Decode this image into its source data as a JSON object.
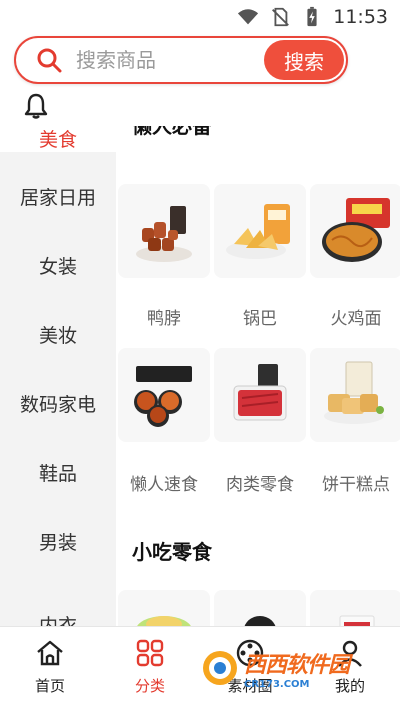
{
  "status": {
    "time": "11:53"
  },
  "search": {
    "placeholder": "搜索商品",
    "button_label": "搜索"
  },
  "sidebar": {
    "items": [
      {
        "label": "美食",
        "active": true
      },
      {
        "label": "居家日用"
      },
      {
        "label": "女装"
      },
      {
        "label": "美妆"
      },
      {
        "label": "数码家电"
      },
      {
        "label": "鞋品"
      },
      {
        "label": "男装"
      },
      {
        "label": "内衣"
      }
    ]
  },
  "content": {
    "sections": [
      {
        "title": "懒人必备",
        "items": [
          {
            "label": "鸭脖",
            "icon": "duck-neck-product"
          },
          {
            "label": "锅巴",
            "icon": "rice-crust-chips-product"
          },
          {
            "label": "火鸡面",
            "icon": "turkey-noodles-product"
          },
          {
            "label": "懒人速食",
            "icon": "instant-hotpot-product"
          },
          {
            "label": "肉类零食",
            "icon": "meat-snacks-product"
          },
          {
            "label": "饼干糕点",
            "icon": "biscuits-cakes-product"
          }
        ]
      },
      {
        "title": "小吃零食",
        "items": [
          {
            "label": "",
            "icon": "snack-bowl-product"
          },
          {
            "label": "",
            "icon": "dark-snack-product"
          },
          {
            "label": "",
            "icon": "packaged-snack-product"
          }
        ]
      }
    ]
  },
  "tabbar": {
    "tabs": [
      {
        "label": "首页",
        "icon": "home-icon"
      },
      {
        "label": "分类",
        "icon": "category-grid-icon",
        "active": true
      },
      {
        "label": "素材圈",
        "icon": "film-reel-icon"
      },
      {
        "label": "我的",
        "icon": "person-icon"
      }
    ]
  },
  "watermark": {
    "title": "西西软件园",
    "sub": "CR173.COM"
  },
  "colors": {
    "accent": "#e33b2f",
    "search_button": "#ef4f3c",
    "sidebar_bg": "#f3f3f3"
  }
}
